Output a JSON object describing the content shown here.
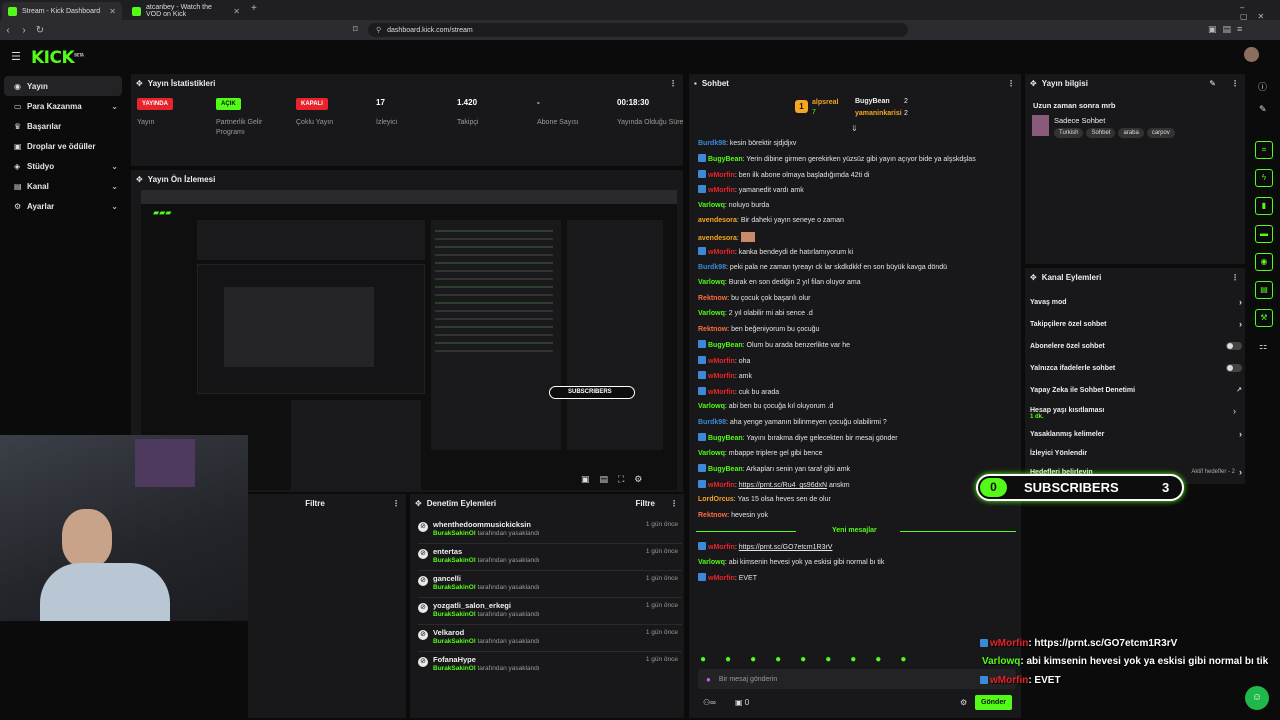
{
  "browser": {
    "tabs": [
      {
        "title": "Stream - Kick Dashboard"
      },
      {
        "title": "atcanbey - Watch the VOD on Kick"
      }
    ],
    "url": "dashboard.kick.com/stream"
  },
  "brand": {
    "logo": "KICK",
    "beta": "BETA",
    "accent": "#53fc18"
  },
  "sidebar": {
    "items": [
      {
        "label": "Yayın",
        "icon": "broadcast-icon"
      },
      {
        "label": "Para Kazanma",
        "icon": "money-icon"
      },
      {
        "label": "Başarılar",
        "icon": "trophy-icon"
      },
      {
        "label": "Droplar ve ödüller",
        "icon": "gift-icon"
      },
      {
        "label": "Stüdyo",
        "icon": "studio-icon"
      },
      {
        "label": "Kanal",
        "icon": "channel-icon"
      },
      {
        "label": "Ayarlar",
        "icon": "gear-icon"
      }
    ]
  },
  "stats": {
    "title": "Yayın İstatistikleri",
    "items": [
      {
        "badge": "YAYINDA",
        "badge_color": "#e8232a",
        "label": "Yayın"
      },
      {
        "badge": "AÇIK",
        "badge_color": "#53fc18",
        "label": "Partnerlik Gelir Programı"
      },
      {
        "badge": "KAPALI",
        "badge_color": "#e8232a",
        "label": "Çoklu Yayın"
      },
      {
        "value": "17",
        "label": "İzleyici"
      },
      {
        "value": "1.420",
        "label": "Takipçi"
      },
      {
        "value": "-",
        "label": "Abone Sayısı"
      },
      {
        "value": "00:18:30",
        "label": "Yayında Olduğu Süre"
      }
    ]
  },
  "preview": {
    "title": "Yayın Ön İzlemesi"
  },
  "filter_label": "Filtre",
  "mod": {
    "title": "Denetim Eylemleri",
    "filter": "Filtre",
    "rows": [
      {
        "name": "whenthedoommusickicksin",
        "by": "BurakSakinOl",
        "action": "tarafından yasaklandı",
        "time": "1 gün önce"
      },
      {
        "name": "entertas",
        "by": "BurakSakinOl",
        "action": "tarafından yasaklandı",
        "time": "1 gün önce"
      },
      {
        "name": "gancelli",
        "by": "BurakSakinOl",
        "action": "tarafından yasaklandı",
        "time": "1 gün önce"
      },
      {
        "name": "yozgatli_salon_erkegi",
        "by": "BurakSakinOl",
        "action": "tarafından yasaklandı",
        "time": "1 gün önce"
      },
      {
        "name": "Velkarod",
        "by": "BurakSakinOl",
        "action": "tarafından yasaklandı",
        "time": "1 gün önce"
      },
      {
        "name": "FofanaHype",
        "by": "BurakSakinOl",
        "action": "tarafından yasaklandı",
        "time": "1 gün önce"
      }
    ]
  },
  "chat": {
    "title": "Sohbet",
    "leaderboard": [
      {
        "rank": "1",
        "name": "alpsreal",
        "count": "7"
      },
      {
        "name": "BugyBean",
        "count": "2"
      },
      {
        "name": "yamaninkarisi",
        "count": "2"
      }
    ],
    "messages": [
      {
        "user": "Burdk98",
        "color": "#3a8ad8",
        "text": "kesin börektir sjdjdjxv"
      },
      {
        "user": "BugyBean",
        "color": "#53fc18",
        "badge": true,
        "text": "Yerin dibine girmen gerekirken yüzsüz gibi yayın açıyor bide ya alşskdşlas"
      },
      {
        "user": "wMorfin",
        "color": "#e8232a",
        "badge": true,
        "text": "ben ilk abone olmaya başladığımda 42ti di"
      },
      {
        "user": "wMorfin",
        "color": "#e8232a",
        "badge": true,
        "text": "yamanedit vardı amk"
      },
      {
        "user": "Varlowq",
        "color": "#53fc18",
        "text": "noluyo burda"
      },
      {
        "user": "avendesora",
        "color": "#f5a623",
        "text": "Bir daheki yayın seneye o zaman"
      },
      {
        "user": "avendesora",
        "color": "#f5a623",
        "text": ""
      },
      {
        "user": "wMorfin",
        "color": "#e8232a",
        "badge": true,
        "text": "kanka bendeydi de hatırlamıyorum ki"
      },
      {
        "user": "Burdk98",
        "color": "#3a8ad8",
        "text": "peki pala ne zaman tyreayı ck lar skdkdkkf en son büyük kavga döndü"
      },
      {
        "user": "Varlowq",
        "color": "#53fc18",
        "text": "Burak en son dediğin 2 yıl filan oluyor ama"
      },
      {
        "user": "Rektnow",
        "color": "#ff6a3d",
        "text": "bu çocuk çok başarılı olur"
      },
      {
        "user": "Varlowq",
        "color": "#53fc18",
        "text": "2 yıl olabilir mi abi sence .d"
      },
      {
        "user": "Rektnow",
        "color": "#ff6a3d",
        "text": "ben beğeniyorum bu çocuğu"
      },
      {
        "user": "BugyBean",
        "color": "#53fc18",
        "badge": true,
        "text": "Olum bu arada benzerlikte var he"
      },
      {
        "user": "wMorfin",
        "color": "#e8232a",
        "badge": true,
        "text": "oha"
      },
      {
        "user": "wMorfin",
        "color": "#e8232a",
        "badge": true,
        "text": "amk"
      },
      {
        "user": "wMorfin",
        "color": "#e8232a",
        "badge": true,
        "text": "cuk bu arada"
      },
      {
        "user": "Varlowq",
        "color": "#53fc18",
        "text": "abi ben bu çocuğa kıl oluyorum .d"
      },
      {
        "user": "Burdk98",
        "color": "#3a8ad8",
        "text": "aha yenge yamanın bilinmeyen çocuğu olabilirmi ?"
      },
      {
        "user": "BugyBean",
        "color": "#53fc18",
        "badge": true,
        "text": "Yayını bırakma diye gelecekten bir mesaj gönder"
      },
      {
        "user": "Varlowq",
        "color": "#53fc18",
        "text": "mbappe triplere gel gibi bence"
      },
      {
        "user": "BugyBean",
        "color": "#53fc18",
        "badge": true,
        "text": "Arkapları senin yan taraf gibi amk"
      },
      {
        "user": "wMorfin",
        "color": "#e8232a",
        "badge": true,
        "text": "https://prnt.sc/Ru4_gs96dxN",
        "link": true,
        "suffix": " anskm"
      },
      {
        "user": "LordOrcus",
        "color": "#f5a623",
        "text": "Yas 15 olsa heves sen de olur"
      },
      {
        "user": "Rektnow",
        "color": "#ff6a3d",
        "text": "hevesin yok"
      }
    ],
    "new_messages_label": "Yeni mesajlar",
    "new_messages": [
      {
        "user": "wMorfin",
        "color": "#e8232a",
        "badge": true,
        "text": "https://prnt.sc/GO7etcm1R3rV",
        "link": true
      },
      {
        "user": "Varlowq",
        "color": "#53fc18",
        "text": "abi kimsenin hevesi yok ya eskisi gibi normal bı tik"
      },
      {
        "user": "wMorfin",
        "color": "#e8232a",
        "badge": true,
        "text": "EVET"
      }
    ],
    "input_placeholder": "Bir mesaj gönderin",
    "send": "Gönder",
    "viewer_count": "0"
  },
  "streaminfo": {
    "title": "Yayın bilgisi",
    "stream_title": "Uzun zaman sonra mrb",
    "category": "Sadece Sohbet",
    "tags": [
      "Turkish",
      "Sohbet",
      "araba",
      "carpov"
    ]
  },
  "channel": {
    "title": "Kanal Eylemleri",
    "rows": [
      {
        "label": "Yavaş mod",
        "kind": "chevron"
      },
      {
        "label": "Takipçilere özel sohbet",
        "kind": "chevron"
      },
      {
        "label": "Abonelere özel sohbet",
        "kind": "toggle"
      },
      {
        "label": "Yalnızca ifadelerle sohbet",
        "kind": "toggle"
      },
      {
        "label": "Yapay Zeka ile Sohbet Denetimi",
        "kind": "external"
      },
      {
        "label": "Hesap yaşı kısıtlaması",
        "sub": "1 dk.",
        "kind": "chevron"
      },
      {
        "label": "Yasaklanmış kelimeler",
        "kind": "chevron"
      },
      {
        "label": "İzleyici Yönlendir",
        "kind": "none"
      },
      {
        "label": "Hedefleri belirleyin",
        "kind": "goals",
        "extra": "Aktif hedefler - 2"
      }
    ]
  },
  "overlay": {
    "subs_count": "0",
    "subs_label": "SUBSCRIBERS",
    "subs_goal": "3",
    "chat": [
      {
        "user": "wMorfin",
        "color": "#e8232a",
        "text": ": https://prnt.sc/GO7etcm1R3rV"
      },
      {
        "user": "Varlowq",
        "color": "#53fc18",
        "text": ": abi kimsenin hevesi yok ya eskisi gibi normal bı tik"
      },
      {
        "user": "wMorfin",
        "color": "#e8232a",
        "text": ": EVET"
      }
    ]
  }
}
